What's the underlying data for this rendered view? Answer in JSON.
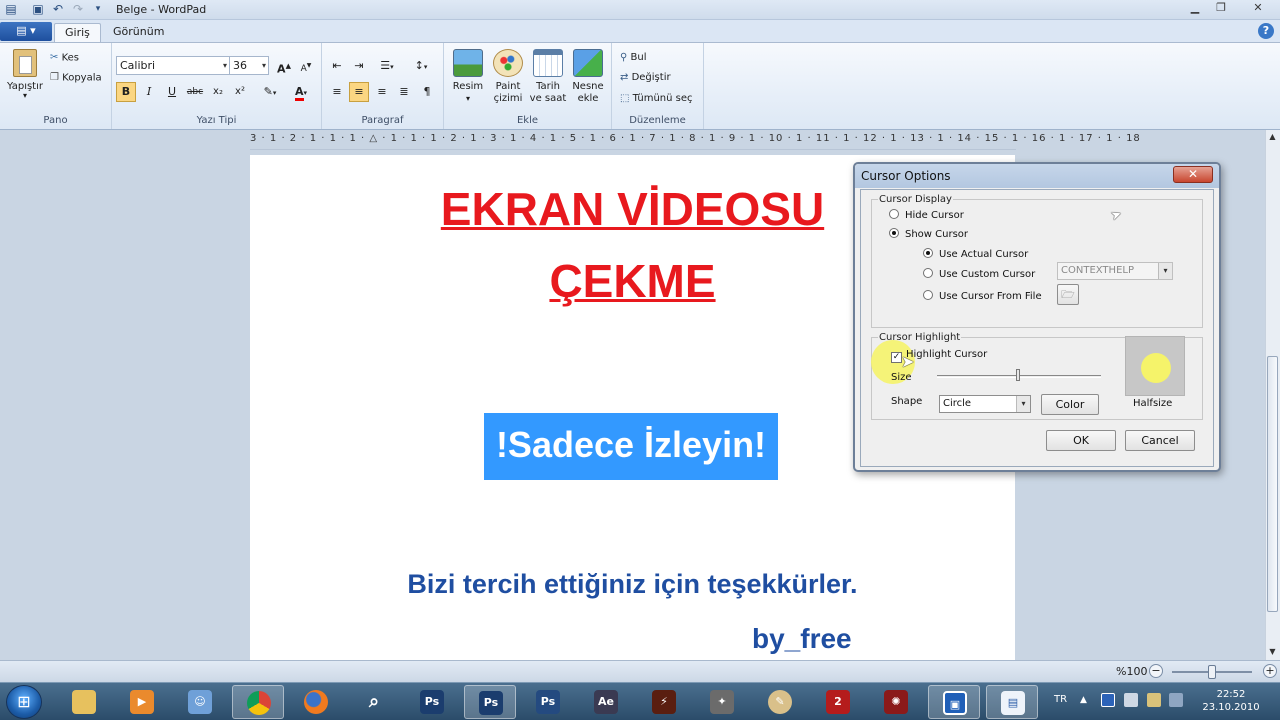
{
  "window": {
    "title": "Belge - WordPad"
  },
  "tabs": {
    "home": "Giriş",
    "view": "Görünüm"
  },
  "ribbon": {
    "clipboard": {
      "paste": "Yapıştır",
      "cut": "Kes",
      "copy": "Kopyala",
      "label": "Pano"
    },
    "font": {
      "family": "Calibri",
      "size": "36",
      "label": "Yazı Tipi"
    },
    "paragraph": {
      "label": "Paragraf"
    },
    "insert": {
      "picture": "Resim",
      "paint_line1": "Paint",
      "paint_line2": "çizimi",
      "datetime_line1": "Tarih",
      "datetime_line2": "ve saat",
      "object_line1": "Nesne",
      "object_line2": "ekle",
      "label": "Ekle"
    },
    "editing": {
      "find": "Bul",
      "replace": "Değiştir",
      "select_all": "Tümünü seç",
      "label": "Düzenleme"
    }
  },
  "ruler": {
    "text": "3 · 1 · 2 · 1 · 1 · 1 · △ · 1 · 1 · 1 · 2 · 1 · 3 · 1 · 4 · 1 · 5 · 1 · 6 · 1 · 7 · 1 · 8 · 1 · 9 · 1 · 10 · 1 · 11 · 1 · 12 · 1 · 13 · 1 · 14 · 15 · 1 · 16 · 1 · 17 · 1 · 18"
  },
  "document": {
    "heading_line1": "EKRAN VİDEOSU",
    "heading_line2": "ÇEKME",
    "selected_text": "!Sadece İzleyin!",
    "thanks": "Bizi tercih ettiğiniz için teşekkürler.",
    "signature": "by_free"
  },
  "status": {
    "zoom": "%100"
  },
  "dialog": {
    "title": "Cursor Options",
    "display_group": "Cursor Display",
    "hide_cursor": "Hide Cursor",
    "show_cursor": "Show Cursor",
    "use_actual": "Use Actual Cursor",
    "use_custom": "Use Custom Cursor",
    "use_file": "Use Cursor From File",
    "custom_value": "CONTEXTHELP",
    "highlight_group": "Cursor Highlight",
    "highlight_cursor": "Highlight Cursor",
    "size_label": "Size",
    "shape_label": "Shape",
    "shape_value": "Circle",
    "color_button": "Color",
    "preview_label": "Halfsize",
    "highlight_color": "#f5f36a",
    "size_level": 0.48,
    "ok": "OK",
    "cancel": "Cancel"
  },
  "taskbar": {
    "lang": "TR",
    "time": "22:52",
    "date": "23.10.2010"
  },
  "colors": {
    "heading": "#e8191e",
    "body_text": "#1f4ea1",
    "selection": "#3399ff"
  }
}
